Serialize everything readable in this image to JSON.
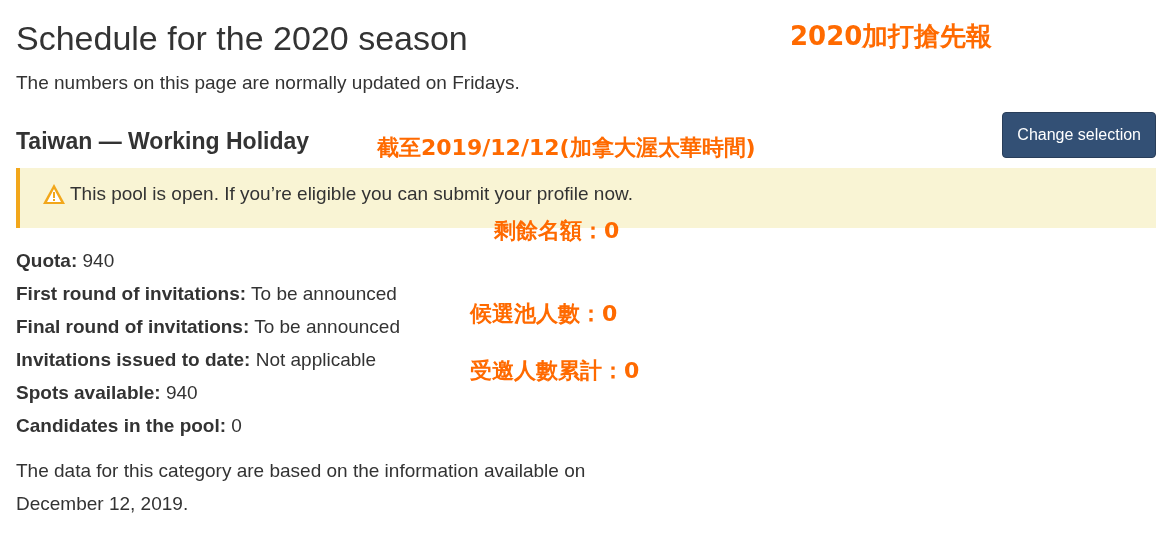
{
  "title": "Schedule for the 2020 season",
  "subtitle": "The numbers on this page are normally updated on Fridays.",
  "category": "Taiwan — Working Holiday",
  "change_button": "Change selection",
  "alert": {
    "text": "This pool is open. If you’re eligible you can submit your profile now."
  },
  "facts": [
    {
      "label": "Quota:",
      "value": "940"
    },
    {
      "label": "First round of invitations:",
      "value": "To be announced"
    },
    {
      "label": "Final round of invitations:",
      "value": "To be announced"
    },
    {
      "label": "Invitations issued to date:",
      "value": "Not applicable"
    },
    {
      "label": "Spots available:",
      "value": "940"
    },
    {
      "label": "Candidates in the pool:",
      "value": "0"
    }
  ],
  "note": "The data for this category are based on the information available on December 12, 2019.",
  "annotations": [
    "2020加打搶先報",
    "截至2019/12/12(加拿大渥太華時間)",
    "剩餘名額：0",
    "候選池人數：0",
    "受邀人數累計：0"
  ]
}
